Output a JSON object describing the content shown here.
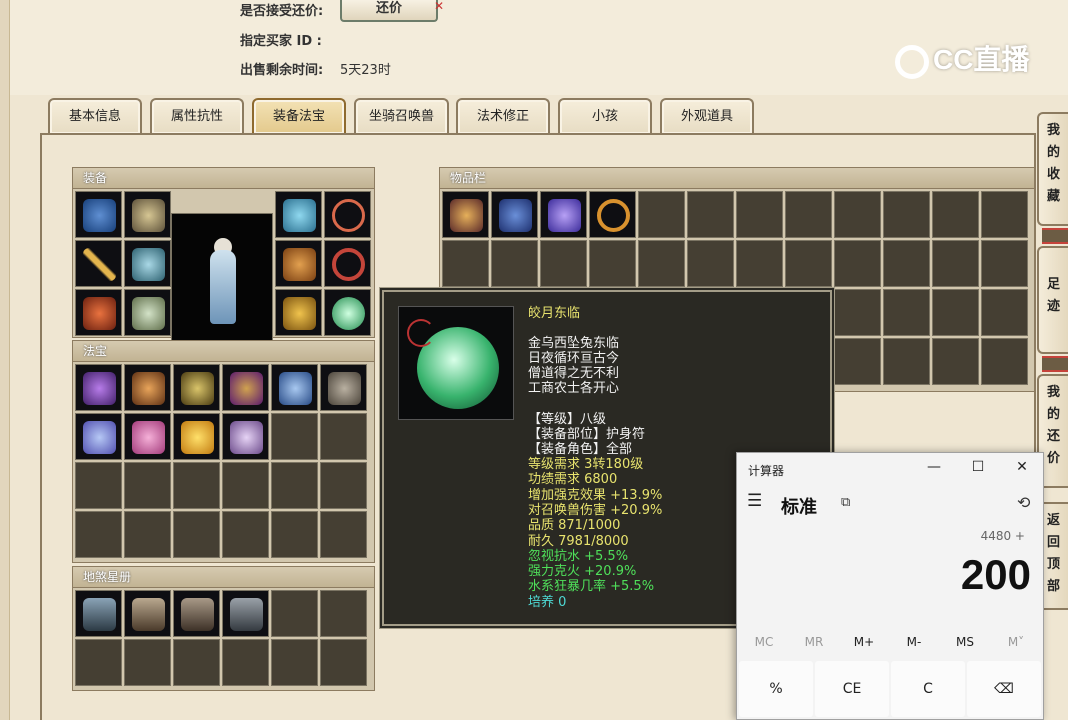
{
  "trade_info": {
    "accept_counter_label": "是否接受还价:",
    "counter_button": "还价",
    "designated_buyer_label": "指定买家 ID :",
    "designated_buyer_value": "",
    "remaining_time_label": "出售剩余时间:",
    "remaining_time_value": "5天23时"
  },
  "watermark": "CC直播",
  "tabs": [
    "基本信息",
    "属性抗性",
    "装备法宝",
    "坐骑召唤兽",
    "法术修正",
    "小孩",
    "外观道具"
  ],
  "active_tab": "装备法宝",
  "sections": {
    "equipment": "装备",
    "treasure": "法宝",
    "star_book": "地煞星册",
    "inventory": "物品栏"
  },
  "tooltip": {
    "name": "皎月东临",
    "desc": [
      "金乌西坠兔东临",
      "日夜循环亘古今",
      "僧道得之无不利",
      "工商农士各开心"
    ],
    "level": "【等级】八级",
    "slot": "【装备部位】护身符",
    "role": "【装备角色】全部",
    "req_level": "等级需求 3转180级",
    "req_merit": "功绩需求 6800",
    "bonus_1": "增加强克效果 +13.9%",
    "bonus_2": "对召唤兽伤害 +20.9%",
    "quality": "品质 871/1000",
    "durability": "耐久 7981/8000",
    "green_1": "忽视抗水 +5.5%",
    "green_2": "强力克火 +20.9%",
    "green_3": "水系狂暴几率 +5.5%",
    "cultivate": "培养 0"
  },
  "side_tabs": {
    "favorites": [
      "我",
      "的",
      "收",
      "藏"
    ],
    "footprint": [
      "足",
      "迹"
    ],
    "my_counter": [
      "我",
      "的",
      "还",
      "价"
    ],
    "back_top": [
      "返",
      "回",
      "顶",
      "部"
    ]
  },
  "calculator": {
    "title": "计算器",
    "minimize": "—",
    "maximize": "☐",
    "close": "✕",
    "menu": "☰",
    "mode": "标准",
    "pin": "⧉",
    "history": "⟲",
    "expression": "4480 +",
    "display": "200",
    "memory": [
      "MC",
      "MR",
      "M+",
      "M-",
      "MS",
      "M˅"
    ],
    "keys": [
      "%",
      "CE",
      "C",
      "⌫"
    ]
  },
  "colors": {
    "tooltip_bg": "#2a2923",
    "name_yellow": "#e8e36e",
    "stat_green": "#4fe05a",
    "cultivate_cyan": "#4ed9d4",
    "active_tab": "#e3c98c"
  },
  "icons": {
    "equipment": [
      "helmet-icon",
      "wing-ornament-icon",
      "mask-icon",
      "necklace-icon",
      "sword-icon",
      "robe-icon",
      "ring-icon",
      "bracelet-icon",
      "charm-icon",
      "boots-icon",
      "crown-icon",
      "amulet-icon"
    ],
    "treasure": [
      "lantern-icon",
      "pipa-icon",
      "hook-icon",
      "talisman-icon",
      "glove-icon",
      "scroll-icon",
      "book-icon",
      "lamp-icon",
      "gold-cloud-icon",
      "spirit-icon"
    ],
    "star_book": [
      "warrior-card-icon",
      "warrior-card-icon",
      "warrior-card-icon",
      "warrior-card-icon"
    ],
    "inventory": [
      "winged-crest-icon",
      "blue-book-icon",
      "purple-scarf-icon",
      "gold-bracelet-icon"
    ]
  }
}
